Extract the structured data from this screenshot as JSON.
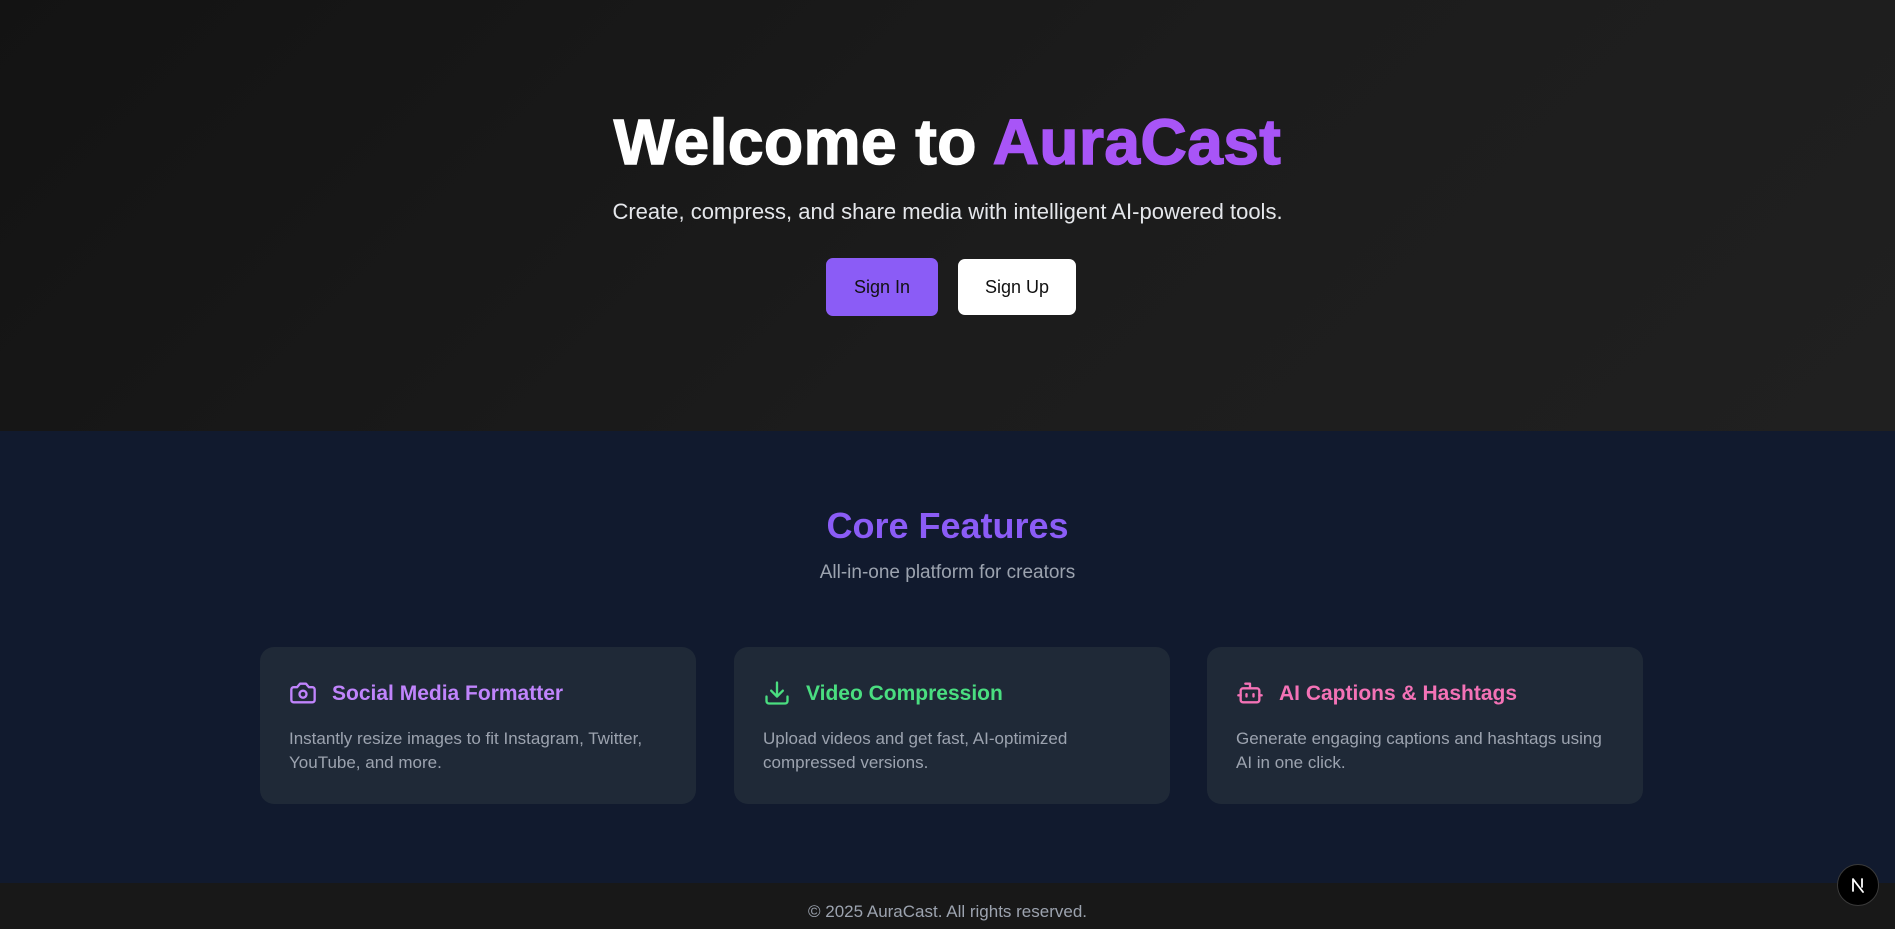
{
  "hero": {
    "title_prefix": "Welcome to ",
    "title_brand": "AuraCast",
    "subtitle": "Create, compress, and share media with intelligent AI-powered tools.",
    "signin_label": "Sign In",
    "signup_label": "Sign Up"
  },
  "features": {
    "title": "Core Features",
    "subtitle": "All-in-one platform for creators",
    "cards": [
      {
        "icon": "camera-icon",
        "title": "Social Media Formatter",
        "description": "Instantly resize images to fit Instagram, Twitter, YouTube, and more.",
        "color": "#c084fc"
      },
      {
        "icon": "download-icon",
        "title": "Video Compression",
        "description": "Upload videos and get fast, AI-optimized compressed versions.",
        "color": "#4ade80"
      },
      {
        "icon": "bot-icon",
        "title": "AI Captions & Hashtags",
        "description": "Generate engaging captions and hashtags using AI in one click.",
        "color": "#f472b6"
      }
    ]
  },
  "footer": {
    "copyright": "© 2025 AuraCast. All rights reserved."
  },
  "colors": {
    "brand": "#a855f7",
    "button_primary": "#8b5cf6",
    "features_bg": "#111a2e",
    "card_bg": "#1f2937"
  },
  "badge": {
    "icon": "nextjs-icon"
  }
}
